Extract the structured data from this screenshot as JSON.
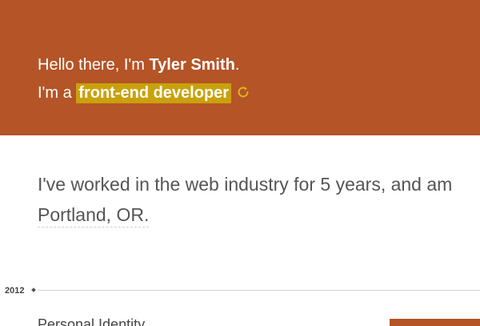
{
  "hero": {
    "greeting_prefix": "Hello there, I'm ",
    "name": "Tyler Smith",
    "greeting_suffix": ".",
    "role_prefix": "I'm a ",
    "role": "front-end developer",
    "refresh_icon": "refresh-icon",
    "background_color": "#b45427",
    "highlight_color": "#c9a10c"
  },
  "intro": {
    "text": "I've worked in the web industry for 5 years, and am",
    "location": "Portland, OR."
  },
  "timeline": {
    "year": "2012"
  },
  "project": {
    "title": "Personal Identity"
  }
}
